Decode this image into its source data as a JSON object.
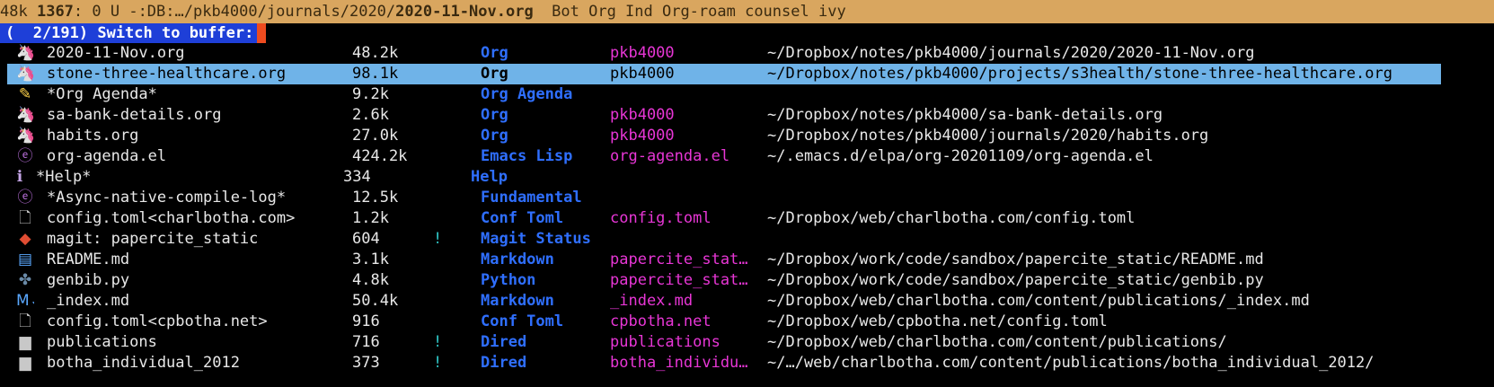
{
  "modeline": {
    "size": "48k",
    "line": "1367",
    "col_state": ": 0 U -:DB:…/pkb4000/journals/2020/",
    "buffer": "2020-11-Nov.org",
    "modes": "  Bot Org Ind Org-roam counsel ivy"
  },
  "prompt": {
    "text": "(  2/191) Switch to buffer:"
  },
  "buffers": [
    {
      "icon": "org-unicorn-icon",
      "glyph": "🦄",
      "name": "2020-11-Nov.org",
      "size": "48.2k",
      "flag": "",
      "mode": "Org",
      "project": "pkb4000",
      "path": "~/Dropbox/notes/pkb4000/journals/2020/2020-11-Nov.org"
    },
    {
      "icon": "org-unicorn-icon",
      "glyph": "🦄",
      "name": "stone-three-healthcare.org",
      "size": "98.1k",
      "flag": "",
      "mode": "Org",
      "project": "pkb4000",
      "path": "~/Dropbox/notes/pkb4000/projects/s3health/stone-three-healthcare.org"
    },
    {
      "icon": "agenda-icon",
      "glyph": "✎",
      "name": "*Org Agenda*",
      "size": "9.2k",
      "flag": "",
      "mode": "Org Agenda",
      "project": "",
      "path": ""
    },
    {
      "icon": "org-unicorn-icon",
      "glyph": "🦄",
      "name": "sa-bank-details.org",
      "size": "2.6k",
      "flag": "",
      "mode": "Org",
      "project": "pkb4000",
      "path": "~/Dropbox/notes/pkb4000/sa-bank-details.org"
    },
    {
      "icon": "org-unicorn-icon",
      "glyph": "🦄",
      "name": "habits.org",
      "size": "27.0k",
      "flag": "",
      "mode": "Org",
      "project": "pkb4000",
      "path": "~/Dropbox/notes/pkb4000/journals/2020/habits.org"
    },
    {
      "icon": "emacs-icon",
      "glyph": "ⓔ",
      "name": "org-agenda.el",
      "size": "424.2k",
      "flag": "",
      "mode": "Emacs Lisp",
      "project": "org-agenda.el",
      "path": "~/.emacs.d/elpa/org-20201109/org-agenda.el"
    },
    {
      "icon": "info-icon",
      "glyph": "ℹ",
      "name": "*Help*",
      "size": "334",
      "flag": "",
      "mode": "Help",
      "project": "",
      "path": ""
    },
    {
      "icon": "emacs-icon",
      "glyph": "ⓔ",
      "name": "*Async-native-compile-log*",
      "size": "12.5k",
      "flag": "",
      "mode": "Fundamental",
      "project": "",
      "path": ""
    },
    {
      "icon": "file-icon",
      "glyph": "🗋",
      "name": "config.toml<charlbotha.com>",
      "size": "1.2k",
      "flag": "",
      "mode": "Conf Toml",
      "project": "config.toml",
      "path": "~/Dropbox/web/charlbotha.com/config.toml"
    },
    {
      "icon": "git-icon",
      "glyph": "◆",
      "name": "magit: papercite_static",
      "size": "604",
      "flag": "!",
      "mode": "Magit Status",
      "project": "",
      "path": ""
    },
    {
      "icon": "readme-icon",
      "glyph": "▤",
      "name": "README.md",
      "size": "3.1k",
      "flag": "",
      "mode": "Markdown",
      "project": "papercite_stat…",
      "path": "~/Dropbox/work/code/sandbox/papercite_static/README.md"
    },
    {
      "icon": "python-icon",
      "glyph": "✤",
      "name": "genbib.py",
      "size": "4.8k",
      "flag": "",
      "mode": "Python",
      "project": "papercite_stat…",
      "path": "~/Dropbox/work/code/sandbox/papercite_static/genbib.py"
    },
    {
      "icon": "markdown-icon",
      "glyph": "M↓",
      "name": "_index.md",
      "size": "50.4k",
      "flag": "",
      "mode": "Markdown",
      "project": "_index.md",
      "path": "~/Dropbox/web/charlbotha.com/content/publications/_index.md"
    },
    {
      "icon": "file-icon",
      "glyph": "🗋",
      "name": "config.toml<cpbotha.net>",
      "size": "916",
      "flag": "",
      "mode": "Conf Toml",
      "project": "cpbotha.net",
      "path": "~/Dropbox/web/cpbotha.net/config.toml"
    },
    {
      "icon": "folder-icon",
      "glyph": "▆",
      "name": "publications",
      "size": "716",
      "flag": "!",
      "mode": "Dired",
      "project": "publications",
      "path": "~/Dropbox/web/charlbotha.com/content/publications/"
    },
    {
      "icon": "folder-icon",
      "glyph": "▆",
      "name": "botha_individual_2012",
      "size": "373",
      "flag": "!",
      "mode": "Dired",
      "project": "botha_individu…",
      "path": "~/…/web/charlbotha.com/content/publications/botha_individual_2012/"
    }
  ]
}
